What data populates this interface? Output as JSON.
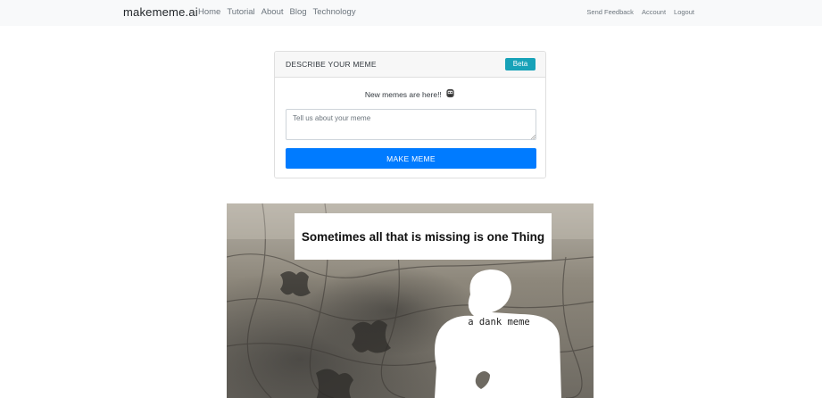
{
  "nav": {
    "brand": "makememe.ai",
    "left_links": [
      "Home",
      "Tutorial",
      "About",
      "Blog",
      "Technology"
    ],
    "right_links": [
      "Send Feedback",
      "Account",
      "Logout"
    ]
  },
  "card": {
    "title": "DESCRIBE YOUR MEME",
    "badge": "Beta",
    "announcement": "New memes are here!!",
    "announcement_icon": "bearded-face-emoji",
    "input_placeholder": "Tell us about your meme",
    "input_value": "",
    "button_label": "MAKE MEME"
  },
  "meme": {
    "top_caption": "Sometimes all that is missing is one  Thing",
    "middle_caption": "a dank meme"
  },
  "colors": {
    "primary": "#007bff",
    "badge": "#17a2b8",
    "navbar_bg": "#f8f9fa",
    "card_header_bg": "#f7f7f7"
  }
}
